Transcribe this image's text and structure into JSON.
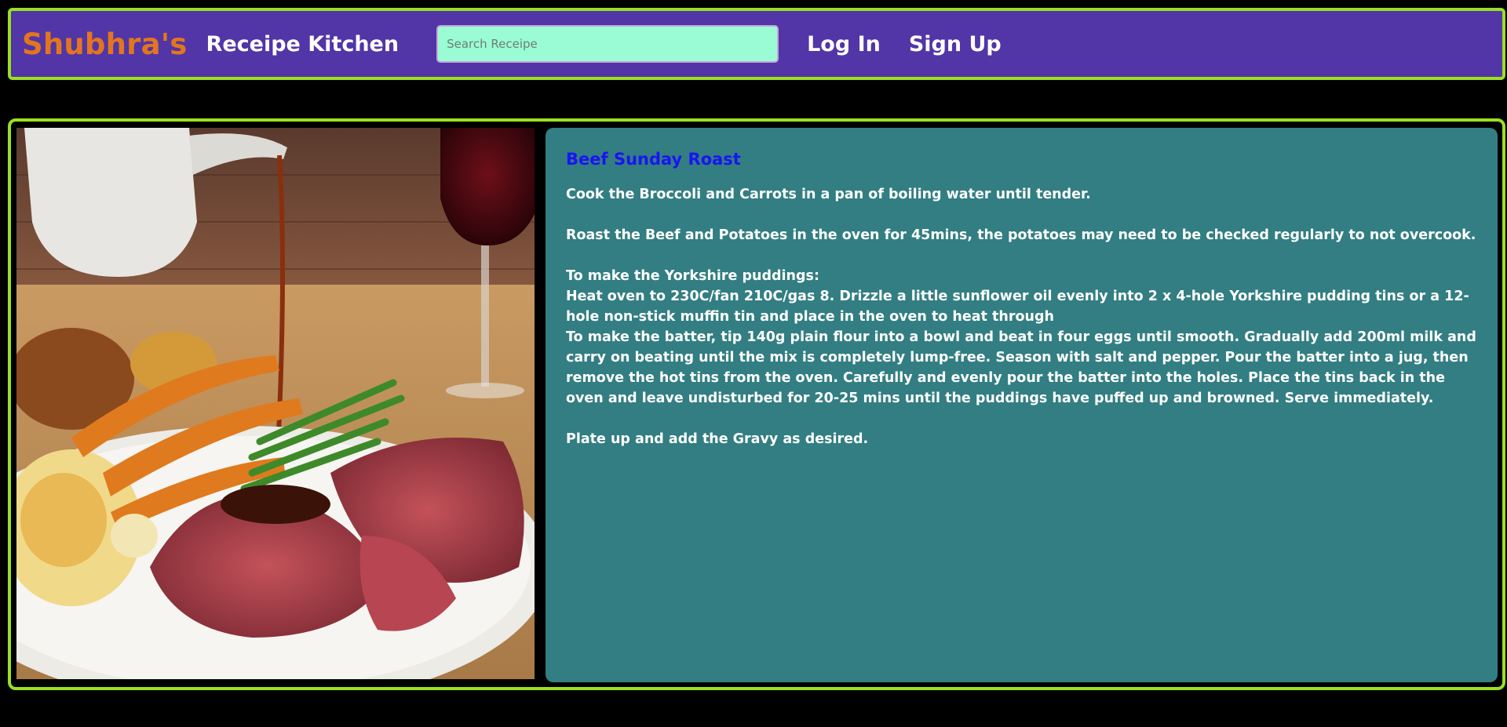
{
  "header": {
    "brand": "Shubhra's",
    "subtitle": "Receipe Kitchen",
    "search_placeholder": "Search Receipe",
    "login_label": "Log In",
    "signup_label": "Sign Up"
  },
  "recipe": {
    "image_icon": "roast-dinner-photo",
    "title": "Beef Sunday Roast",
    "steps": {
      "s1": "Cook the Broccoli and Carrots in a pan of boiling water until tender.",
      "s2": "Roast the Beef and Potatoes in the oven for 45mins, the potatoes may need to be checked regularly to not overcook.",
      "s3": "To make the Yorkshire puddings:",
      "s4": "Heat oven to 230C/fan 210C/gas 8. Drizzle a little sunflower oil evenly into 2 x 4-hole Yorkshire pudding tins or a 12-hole non-stick muffin tin and place in the oven to heat through",
      "s5": "To make the batter, tip 140g plain flour into a bowl and beat in four eggs until smooth. Gradually add 200ml milk and carry on beating until the mix is completely lump-free. Season with salt and pepper. Pour the batter into a jug, then remove the hot tins from the oven. Carefully and evenly pour the batter into the holes. Place the tins back in the oven and leave undisturbed for 20-25 mins until the puddings have puffed up and browned. Serve immediately.",
      "s6": "Plate up and add the Gravy as desired."
    }
  },
  "colors": {
    "background": "#000000",
    "navbar": "#5235a6",
    "border_accent": "#9be021",
    "brand": "#e2761f",
    "search_bg": "#99fcd4",
    "recipe_panel": "#327e82",
    "recipe_title": "#1a14f2",
    "text": "#ffffff"
  }
}
